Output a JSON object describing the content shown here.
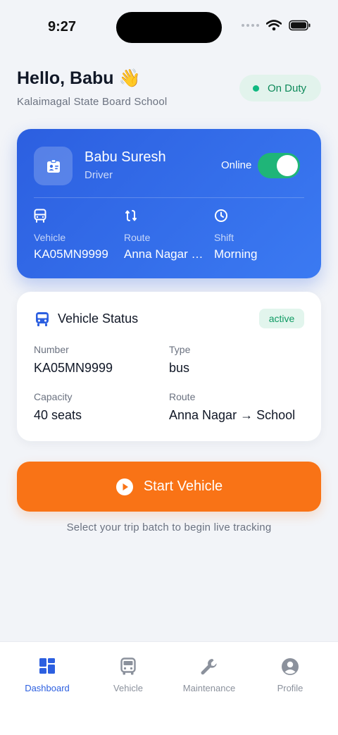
{
  "status_bar": {
    "time": "9:27"
  },
  "header": {
    "greeting": "Hello, Babu 👋",
    "school": "Kalaimagal State Board School",
    "duty_status": "On Duty"
  },
  "driver_card": {
    "name": "Babu Suresh",
    "role": "Driver",
    "online_label": "Online",
    "online": true,
    "fields": [
      {
        "label": "Vehicle",
        "value": "KA05MN9999",
        "icon": "bus-icon"
      },
      {
        "label": "Route",
        "value": "Anna Nagar → School",
        "icon": "route-icon"
      },
      {
        "label": "Shift",
        "value": "Morning",
        "icon": "clock-icon"
      }
    ]
  },
  "vehicle_status": {
    "title": "Vehicle Status",
    "badge": "active",
    "fields": [
      {
        "label": "Number",
        "value": "KA05MN9999"
      },
      {
        "label": "Type",
        "value": "bus"
      },
      {
        "label": "Capacity",
        "value": "40 seats"
      },
      {
        "label": "Route",
        "value": "Anna Nagar → School"
      }
    ]
  },
  "start_button": {
    "label": "Start Vehicle",
    "icon": "play-icon"
  },
  "hint": "Select your trip batch to begin live tracking",
  "tabs": [
    {
      "label": "Dashboard",
      "icon": "dashboard-icon",
      "active": true
    },
    {
      "label": "Vehicle",
      "icon": "bus-icon",
      "active": false
    },
    {
      "label": "Maintenance",
      "icon": "wrench-icon",
      "active": false
    },
    {
      "label": "Profile",
      "icon": "profile-icon",
      "active": false
    }
  ],
  "colors": {
    "primary": "#2c5fe0",
    "accent": "#f97316",
    "success": "#10b981",
    "background": "#f2f4f8"
  }
}
